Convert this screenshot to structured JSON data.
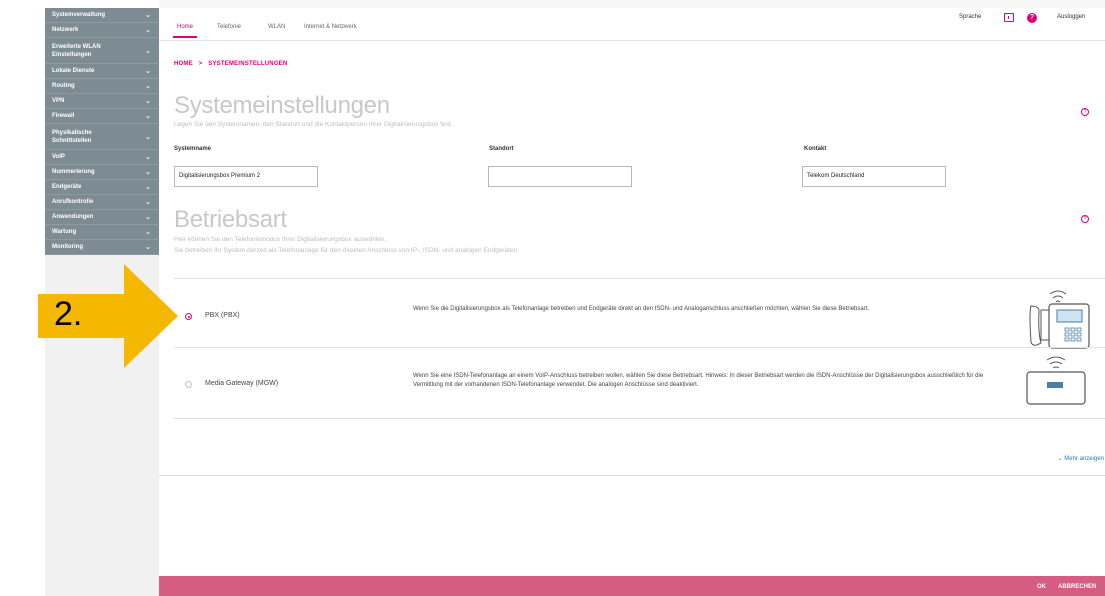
{
  "sidebar": {
    "items": [
      {
        "label": "Systemverwaltung"
      },
      {
        "label": "Netzwerk"
      },
      {
        "label": "Erweiterte WLAN Einstellungen"
      },
      {
        "label": "Lokale Dienste"
      },
      {
        "label": "Routing"
      },
      {
        "label": "VPN"
      },
      {
        "label": "Firewall"
      },
      {
        "label": "Physikalische Schnittstellen"
      },
      {
        "label": "VoIP"
      },
      {
        "label": "Nummerierung"
      },
      {
        "label": "Endgeräte"
      },
      {
        "label": "Anrufkontrolle"
      },
      {
        "label": "Anwendungen"
      },
      {
        "label": "Wartung"
      },
      {
        "label": "Monitoring"
      }
    ]
  },
  "tabs": [
    {
      "label": "Home"
    },
    {
      "label": "Telefonie"
    },
    {
      "label": "WLAN"
    },
    {
      "label": "Internet & Netzwerk"
    }
  ],
  "topright": {
    "sprache": "Sprache",
    "logout": "Ausloggen"
  },
  "breadcrumb": {
    "home": "HOME",
    "sep": ">",
    "current": "SYSTEMEINSTELLUNGEN"
  },
  "system": {
    "title": "Systemeinstellungen",
    "subtitle": "Legen Sie den Systemnamen, den Standort und die Kontaktperson Ihrer Digitalisierungsbox fest.",
    "fields": [
      {
        "label": "Systemname",
        "value": "Digitalisierungsbox Premium 2"
      },
      {
        "label": "Standort",
        "value": ""
      },
      {
        "label": "Kontakt",
        "value": "Telekom Deutschland"
      }
    ]
  },
  "mode": {
    "title": "Betriebsart",
    "subtitle1": "Hier können Sie den Telefoniemodus Ihrer Digitalisierungsbox auswählen.",
    "subtitle2": "Sie betreiben Ihr System derzeit als Telefonanlage für den direkten Anschluss von IP-, ISDN- und analogen Endgeräten.",
    "options": [
      {
        "label": "PBX (PBX)",
        "selected": true,
        "desc": "Wenn Sie die Digitalisierungsbox als Telefonanlage betreiben und Endgeräte direkt an den ISDN- und Analoganschluss anschließen möchten, wählen Sie diese Betriebsart."
      },
      {
        "label": "Media Gateway (MGW)",
        "selected": false,
        "desc": "Wenn Sie eine ISDN-Telefonanlage an einem VoIP-Anschluss betreiben wollen, wählen Sie diese Betriebsart. Hinweis: In dieser Betriebsart werden die ISDN-Anschlüsse der Digitalisierungsbox ausschließlich für die Vermittlung mit der vorhandenen ISDN-Telefonanlage verwendet. Die analogen Anschlüsse sind deaktiviert."
      }
    ],
    "more": "Mehr anzeigen"
  },
  "footer": {
    "ok": "OK",
    "cancel": "ABBRECHEN"
  },
  "annotation": {
    "number": "2."
  },
  "colors": {
    "accent": "#e20074",
    "sidebar": "#7d8b93",
    "footer": "#d55c83",
    "arrow": "#f5b800"
  }
}
